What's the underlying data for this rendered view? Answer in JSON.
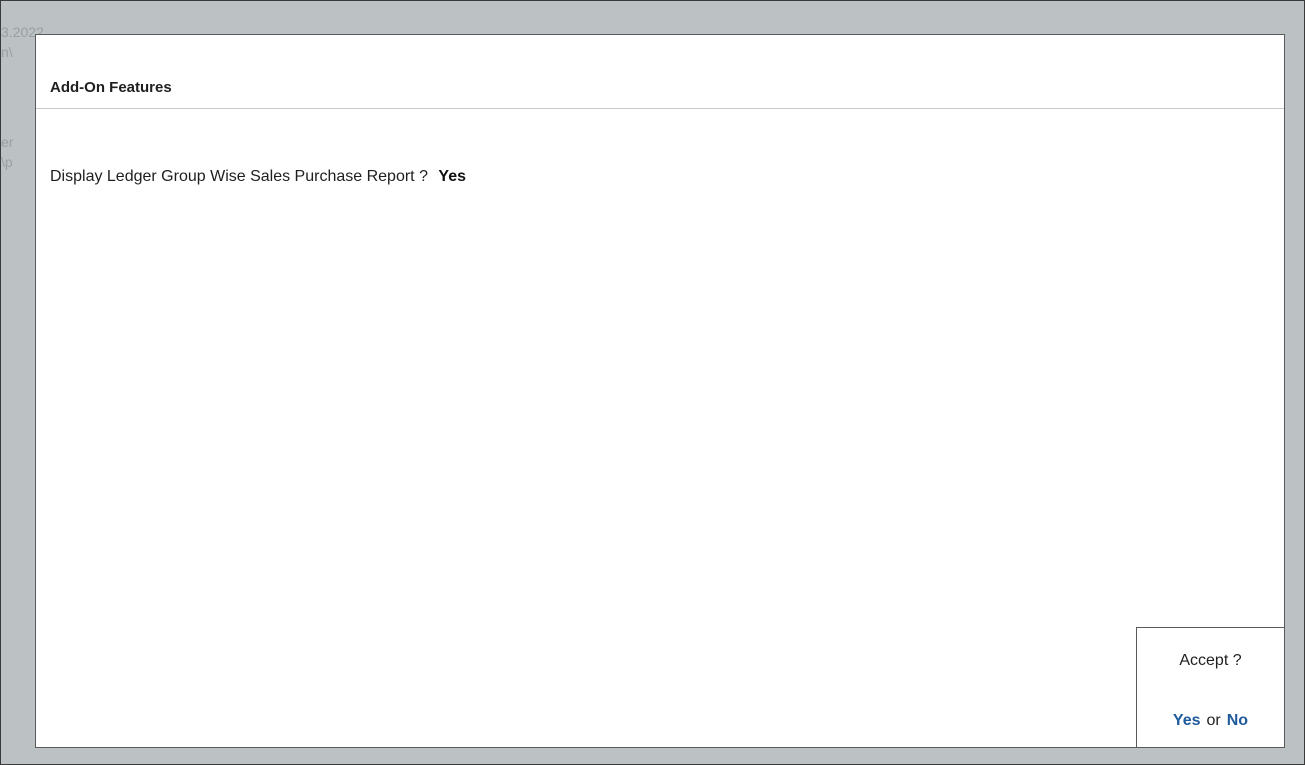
{
  "background_text": [
    "3.2022",
    "n\\",
    "er",
    "\\p"
  ],
  "panel": {
    "title": "Add-On Features",
    "question": {
      "label": "Display Ledger Group Wise Sales Purchase Report ?",
      "value": "Yes"
    }
  },
  "accept": {
    "prompt": "Accept ?",
    "yes_label": "Yes",
    "separator": "or",
    "no_label": "No"
  },
  "colors": {
    "background": "#bcc1c3",
    "panel": "#ffffff",
    "option_link": "#1e5a9c"
  }
}
